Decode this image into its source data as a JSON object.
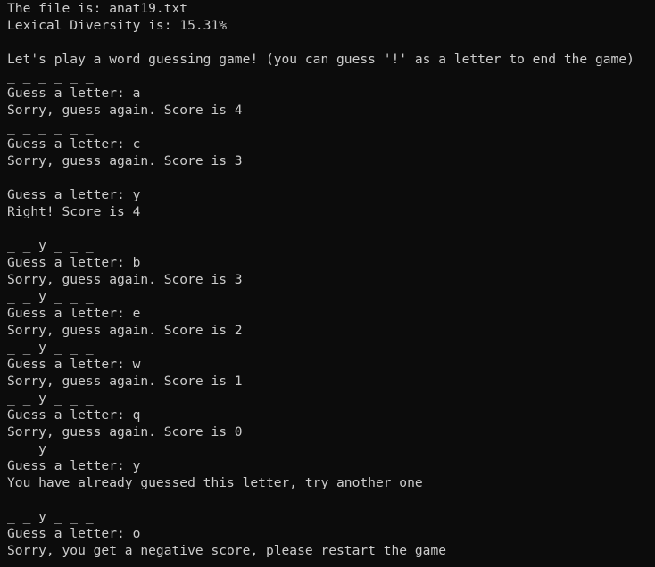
{
  "terminal": {
    "lines": [
      "The file is: anat19.txt",
      "Lexical Diversity is: 15.31%",
      "",
      "Let's play a word guessing game! (you can guess '!' as a letter to end the game)",
      "_ _ _ _ _ _",
      "Guess a letter: a",
      "Sorry, guess again. Score is 4",
      "_ _ _ _ _ _",
      "Guess a letter: c",
      "Sorry, guess again. Score is 3",
      "_ _ _ _ _ _",
      "Guess a letter: y",
      "Right! Score is 4",
      "",
      "_ _ y _ _ _",
      "Guess a letter: b",
      "Sorry, guess again. Score is 3",
      "_ _ y _ _ _",
      "Guess a letter: e",
      "Sorry, guess again. Score is 2",
      "_ _ y _ _ _",
      "Guess a letter: w",
      "Sorry, guess again. Score is 1",
      "_ _ y _ _ _",
      "Guess a letter: q",
      "Sorry, guess again. Score is 0",
      "_ _ y _ _ _",
      "Guess a letter: y",
      "You have already guessed this letter, try another one",
      "",
      "_ _ y _ _ _",
      "Guess a letter: o",
      "Sorry, you get a negative score, please restart the game"
    ]
  }
}
